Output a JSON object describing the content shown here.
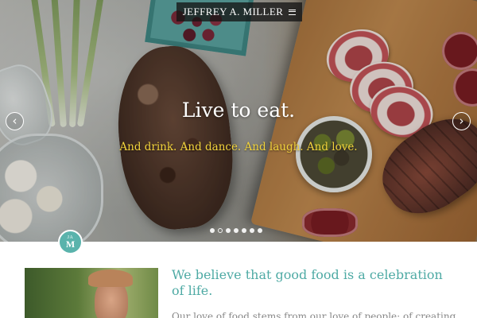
{
  "header": {
    "brand": "JEFFREY A. MILLER",
    "menu_icon": "hamburger-menu-icon"
  },
  "hero": {
    "title": "Live to eat.",
    "subtitle": "And drink. And dance. And laugh. And love.",
    "prev_icon": "chevron-left-icon",
    "next_icon": "chevron-right-icon",
    "slide_count": 7,
    "active_slide": 1
  },
  "logo": {
    "top": "JA",
    "bottom": "M"
  },
  "intro": {
    "headline": "We believe that good food is a celebration of life.",
    "body": "Our love of food stems from our love of people; of creating"
  },
  "colors": {
    "accent": "#4eaaa4",
    "subtitle": "#f2d33c",
    "brand_bar": "#141414"
  }
}
